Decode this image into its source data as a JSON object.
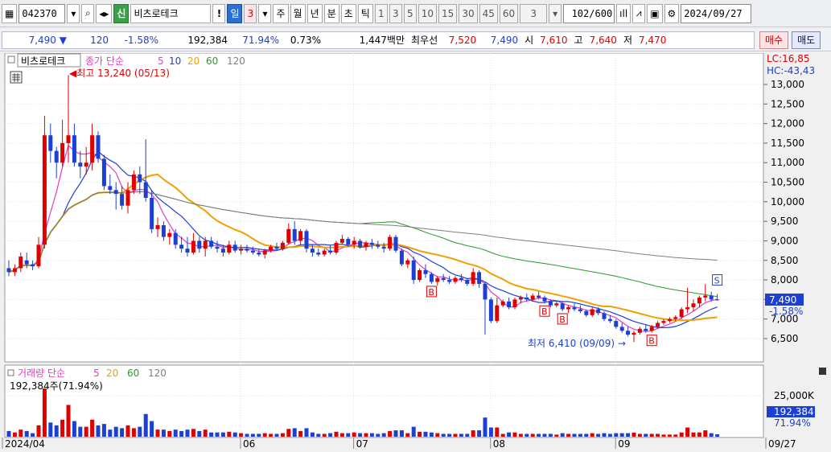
{
  "toolbar": {
    "code": "042370",
    "name_badge": "신",
    "name": "비츠로테크",
    "period_buttons": [
      "일",
      "3",
      "주",
      "월",
      "년",
      "분",
      "초",
      "틱"
    ],
    "interval_buttons": [
      "1",
      "3",
      "5",
      "10",
      "15",
      "30",
      "45",
      "60"
    ],
    "count_select": "3",
    "count": "102",
    "count_total": "/600",
    "date": "2024/09/27"
  },
  "quote": {
    "price": "7,490",
    "change": "120",
    "change_pct": "-1.58%",
    "volume": "192,384",
    "vol_ratio": "71.94%",
    "turnover_pct": "0.73%",
    "amount": "1,447백만",
    "best_label": "최우선",
    "best_ask": "7,520",
    "best_bid": "7,490",
    "open_label": "시",
    "open": "7,610",
    "high_label": "고",
    "high": "7,640",
    "low_label": "저",
    "low": "7,470",
    "buy_btn": "매수",
    "sell_btn": "매도"
  },
  "legend": {
    "name": "비츠로테크",
    "price_label": "종가 단순",
    "ma": [
      "5",
      "10",
      "20",
      "60",
      "120"
    ],
    "volume_label": "거래량 단순",
    "volume_readout": "192,384주(71.94%)"
  },
  "colors": {
    "up": "#e00000",
    "down": "#1c3fd4",
    "ma5": "#e33cc0",
    "ma10": "#1f3fd0",
    "ma20": "#f0a000",
    "ma60": "#2a9a2a",
    "ma120": "#7f7f7f"
  },
  "annotations": {
    "high": "최고 13,240 (05/13)",
    "low": "최저 6,410 (09/09)",
    "lc": "LC:16,85",
    "hc": "HC:-43,43",
    "price_tag": "7,490",
    "pct_tag": "-1.58%",
    "vol_tag": "192,384",
    "vol_pct_tag": "71.94%"
  },
  "chart_data": {
    "type": "candlestick",
    "price_axis": {
      "ticks": [
        "6,500",
        "7,000",
        "7,500",
        "8,000",
        "8,500",
        "9,000",
        "9,500",
        "10,000",
        "10,500",
        "11,000",
        "11,500",
        "12,000",
        "12,500",
        "13,000"
      ],
      "ylim": [
        6150,
        13350
      ]
    },
    "volume_axis": {
      "ticks": [
        "25,000K"
      ]
    },
    "x_labels": [
      {
        "label": "2024/04",
        "index": 0
      },
      {
        "label": "06",
        "index": 40
      },
      {
        "label": "07",
        "index": 59
      },
      {
        "label": "08",
        "index": 82
      },
      {
        "label": "09",
        "index": 103
      },
      {
        "label": "09/27",
        "index": 124
      }
    ],
    "candles": [
      [
        8300,
        8500,
        8100,
        8200
      ],
      [
        8200,
        8400,
        8100,
        8300
      ],
      [
        8300,
        8700,
        8200,
        8600
      ],
      [
        8500,
        8700,
        8300,
        8400
      ],
      [
        8400,
        8500,
        8250,
        8350
      ],
      [
        8350,
        9100,
        8300,
        8900
      ],
      [
        8900,
        12200,
        8800,
        11700
      ],
      [
        11700,
        12000,
        11000,
        11300
      ],
      [
        11300,
        11400,
        10600,
        11000
      ],
      [
        11000,
        12100,
        10900,
        11500
      ],
      [
        11500,
        13240,
        11000,
        11700
      ],
      [
        11700,
        12000,
        10900,
        11000
      ],
      [
        11000,
        11300,
        10600,
        10900
      ],
      [
        10900,
        11400,
        10700,
        11000
      ],
      [
        11000,
        12000,
        10800,
        11700
      ],
      [
        11700,
        11800,
        11000,
        11100
      ],
      [
        11100,
        11200,
        10300,
        10400
      ],
      [
        10400,
        10700,
        10200,
        10300
      ],
      [
        10300,
        10500,
        9800,
        10200
      ],
      [
        10200,
        10400,
        9800,
        9900
      ],
      [
        9900,
        10500,
        9700,
        10300
      ],
      [
        10300,
        10800,
        10200,
        10700
      ],
      [
        10700,
        10900,
        10200,
        10500
      ],
      [
        10500,
        11600,
        10000,
        10100
      ],
      [
        10100,
        10300,
        9200,
        9300
      ],
      [
        9300,
        9600,
        9100,
        9400
      ],
      [
        9400,
        9500,
        9000,
        9100
      ],
      [
        9100,
        9300,
        8900,
        9200
      ],
      [
        9200,
        9300,
        8800,
        8900
      ],
      [
        8900,
        9100,
        8700,
        8800
      ],
      [
        8800,
        9100,
        8600,
        8700
      ],
      [
        8700,
        9200,
        8650,
        9000
      ],
      [
        9000,
        9100,
        8700,
        8800
      ],
      [
        8800,
        9100,
        8600,
        9000
      ],
      [
        9000,
        9100,
        8800,
        8850
      ],
      [
        8850,
        9000,
        8700,
        8800
      ],
      [
        8800,
        8900,
        8600,
        8700
      ],
      [
        8700,
        9000,
        8650,
        8900
      ],
      [
        8900,
        9000,
        8700,
        8750
      ],
      [
        8750,
        8900,
        8650,
        8800
      ],
      [
        8800,
        8900,
        8700,
        8750
      ],
      [
        8750,
        8850,
        8650,
        8700
      ],
      [
        8700,
        8800,
        8600,
        8650
      ],
      [
        8650,
        8800,
        8550,
        8750
      ],
      [
        8750,
        8900,
        8700,
        8850
      ],
      [
        8850,
        8950,
        8750,
        8800
      ],
      [
        8800,
        9000,
        8750,
        8950
      ],
      [
        8950,
        9450,
        8900,
        9300
      ],
      [
        9300,
        9500,
        8900,
        9000
      ],
      [
        9000,
        9300,
        8900,
        9250
      ],
      [
        9250,
        9300,
        8700,
        8800
      ],
      [
        8800,
        8900,
        8600,
        8700
      ],
      [
        8700,
        8800,
        8600,
        8650
      ],
      [
        8650,
        8800,
        8600,
        8750
      ],
      [
        8750,
        8900,
        8650,
        8700
      ],
      [
        8700,
        9000,
        8650,
        8950
      ],
      [
        8950,
        9150,
        8900,
        9050
      ],
      [
        9050,
        9100,
        8850,
        8900
      ],
      [
        8900,
        9100,
        8800,
        9000
      ],
      [
        9000,
        9050,
        8800,
        8850
      ],
      [
        8850,
        9000,
        8750,
        8950
      ],
      [
        8950,
        9050,
        8800,
        8900
      ],
      [
        8900,
        9000,
        8800,
        8850
      ],
      [
        8850,
        8950,
        8700,
        8800
      ],
      [
        8800,
        9150,
        8750,
        9100
      ],
      [
        9100,
        9150,
        8700,
        8750
      ],
      [
        8750,
        8800,
        8350,
        8400
      ],
      [
        8400,
        8550,
        8300,
        8500
      ],
      [
        8500,
        8600,
        7900,
        8000
      ],
      [
        8000,
        8300,
        7950,
        8250
      ],
      [
        8250,
        8400,
        8050,
        8150
      ],
      [
        8150,
        8200,
        7900,
        7950
      ],
      [
        7950,
        8100,
        7850,
        8050
      ],
      [
        8050,
        8150,
        7950,
        8000
      ],
      [
        8000,
        8100,
        7900,
        7950
      ],
      [
        7950,
        8100,
        7900,
        8050
      ],
      [
        8050,
        8150,
        7950,
        8000
      ],
      [
        8000,
        8050,
        7850,
        7900
      ],
      [
        7900,
        8300,
        7850,
        8200
      ],
      [
        8200,
        8250,
        7800,
        7900
      ],
      [
        7900,
        7950,
        6600,
        7500
      ],
      [
        7500,
        7550,
        6900,
        6950
      ],
      [
        6950,
        7550,
        6900,
        7350
      ],
      [
        7350,
        7500,
        7300,
        7450
      ],
      [
        7450,
        7550,
        7250,
        7300
      ],
      [
        7300,
        7550,
        7250,
        7500
      ],
      [
        7500,
        7600,
        7400,
        7550
      ],
      [
        7550,
        7650,
        7450,
        7500
      ],
      [
        7500,
        7650,
        7450,
        7600
      ],
      [
        7600,
        7700,
        7500,
        7550
      ],
      [
        7550,
        7600,
        7400,
        7450
      ],
      [
        7450,
        7500,
        7300,
        7350
      ],
      [
        7350,
        7450,
        7300,
        7400
      ],
      [
        7400,
        7450,
        7200,
        7250
      ],
      [
        7250,
        7350,
        7150,
        7300
      ],
      [
        7300,
        7400,
        7200,
        7250
      ],
      [
        7250,
        7350,
        7150,
        7200
      ],
      [
        7200,
        7250,
        7050,
        7100
      ],
      [
        7100,
        7300,
        7050,
        7250
      ],
      [
        7250,
        7300,
        7100,
        7150
      ],
      [
        7150,
        7200,
        6950,
        7000
      ],
      [
        7000,
        7100,
        6900,
        6950
      ],
      [
        6950,
        7000,
        6750,
        6800
      ],
      [
        6800,
        6900,
        6650,
        6700
      ],
      [
        6700,
        6800,
        6550,
        6600
      ],
      [
        6600,
        6700,
        6410,
        6650
      ],
      [
        6650,
        6800,
        6600,
        6750
      ],
      [
        6750,
        6850,
        6650,
        6700
      ],
      [
        6700,
        6850,
        6650,
        6800
      ],
      [
        6800,
        6950,
        6750,
        6900
      ],
      [
        6900,
        7000,
        6850,
        6950
      ],
      [
        6950,
        7050,
        6900,
        7000
      ],
      [
        7000,
        7100,
        6950,
        7050
      ],
      [
        7050,
        7300,
        7000,
        7250
      ],
      [
        7250,
        7800,
        7150,
        7300
      ],
      [
        7300,
        7500,
        7200,
        7400
      ],
      [
        7400,
        7600,
        7300,
        7550
      ],
      [
        7550,
        7900,
        7450,
        7600
      ],
      [
        7600,
        7700,
        7450,
        7500
      ],
      [
        7500,
        7640,
        7470,
        7490
      ]
    ],
    "marks": [
      {
        "label": "B",
        "index": 71
      },
      {
        "label": "B",
        "index": 90
      },
      {
        "label": "B",
        "index": 93
      },
      {
        "label": "B",
        "index": 108
      },
      {
        "label": "S",
        "index": 119
      }
    ]
  }
}
